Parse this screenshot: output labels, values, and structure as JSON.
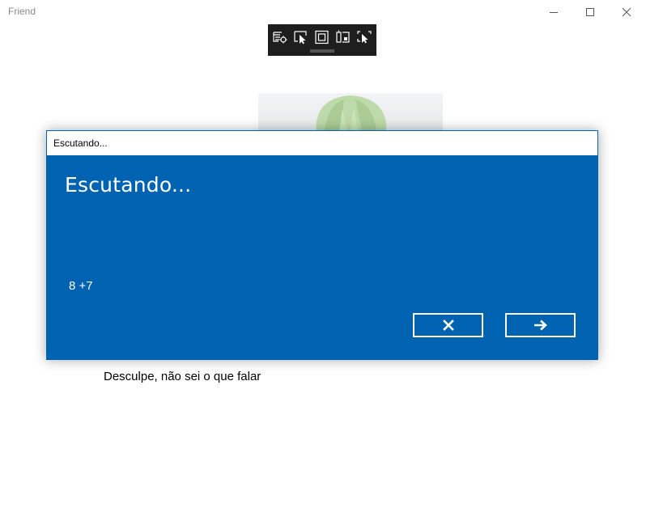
{
  "window": {
    "title": "Friend",
    "controls": [
      "minimize-icon",
      "maximize-icon",
      "close-icon"
    ]
  },
  "debug_toolbar": {
    "icons": [
      "live-visual-tree-icon",
      "select-element-icon",
      "display-layout-adorners-icon",
      "track-focused-element-icon",
      "hot-reload-icon"
    ]
  },
  "avatar": {
    "icon": "anime-avatar-image"
  },
  "speech_dialog": {
    "header": "Escutando...",
    "title": "Escutando...",
    "recognized_text": "8 +7",
    "cancel_icon": "close-icon",
    "continue_icon": "arrow-right-icon",
    "colors": {
      "accent": "#0063b1",
      "text": "#ffffff"
    }
  },
  "response": {
    "text": "Desculpe, não sei o que falar"
  }
}
